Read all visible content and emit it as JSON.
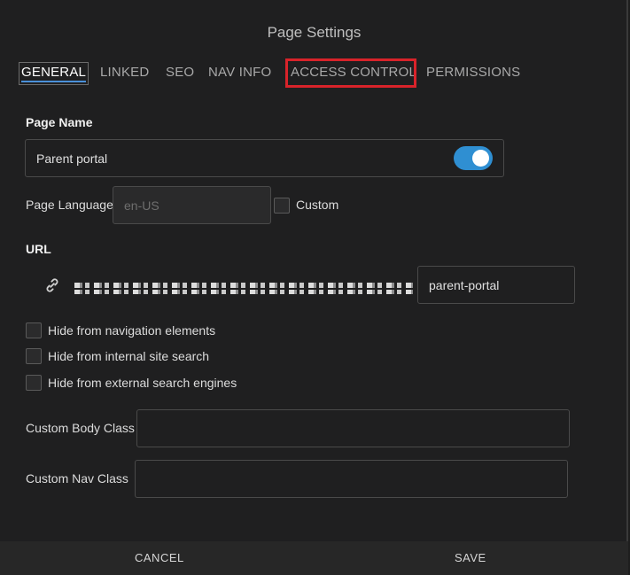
{
  "dialog": {
    "title": "Page Settings"
  },
  "tabs": [
    {
      "label": "GENERAL",
      "active": true
    },
    {
      "label": "LINKED"
    },
    {
      "label": "SEO"
    },
    {
      "label": "NAV INFO"
    },
    {
      "label": "ACCESS CONTROL",
      "highlighted": true
    },
    {
      "label": "PERMISSIONS"
    }
  ],
  "page_name": {
    "label": "Page Name",
    "value": "Parent portal",
    "toggle_on": true
  },
  "page_language": {
    "label": "Page Language",
    "placeholder": "en-US",
    "custom_label": "Custom",
    "custom_checked": false
  },
  "url": {
    "label": "URL",
    "slug": "parent-portal"
  },
  "checkboxes": [
    {
      "label": "Hide from navigation elements",
      "checked": false
    },
    {
      "label": "Hide from internal site search",
      "checked": false
    },
    {
      "label": "Hide from external search engines",
      "checked": false
    }
  ],
  "custom_body_class": {
    "label": "Custom Body Class",
    "value": ""
  },
  "custom_nav_class": {
    "label": "Custom Nav Class",
    "value": ""
  },
  "footer": {
    "cancel_label": "CANCEL",
    "save_label": "SAVE"
  },
  "colors": {
    "accent": "#2f8fd2",
    "highlight": "#d8232a",
    "background": "#1f1f20"
  },
  "icons": {
    "url": "link-icon"
  }
}
